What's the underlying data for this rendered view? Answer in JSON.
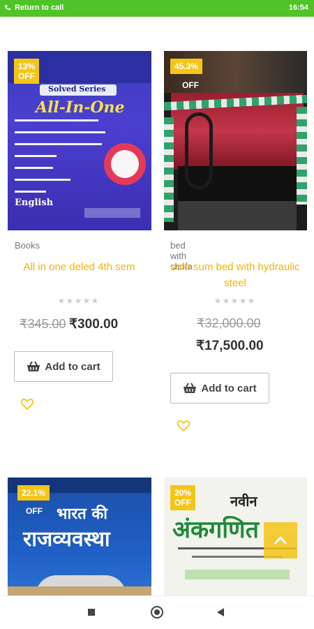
{
  "status": {
    "return_call": "Return to call",
    "time": "16:54"
  },
  "products": [
    {
      "badge": "13% OFF",
      "category": "Books",
      "title": "All in one deled 4th sem",
      "price_old": "₹345.00",
      "price_new": "₹300.00",
      "cart_label": "Add to cart",
      "cover_lines": [
        "Solved Series",
        "All-In-One",
        "English"
      ]
    },
    {
      "badge": "45.3%",
      "off": "OFF",
      "category": "bed with shofa",
      "title": "sofa sum bed with hydraulic steel",
      "price_old": "₹32,000.00",
      "price_new": "₹17,500.00",
      "cart_label": "Add to cart"
    },
    {
      "badge": "22.1%",
      "off": "OFF",
      "cover_title": "भारत की",
      "cover_title2": "राजव्यवस्था"
    },
    {
      "badge": "20% OFF",
      "cover_title": "नवीन",
      "cover_title2": "अंकगणित"
    }
  ],
  "colors": {
    "accent": "#f5c518",
    "status_bar": "#4fc327",
    "title": "#f5b301"
  }
}
